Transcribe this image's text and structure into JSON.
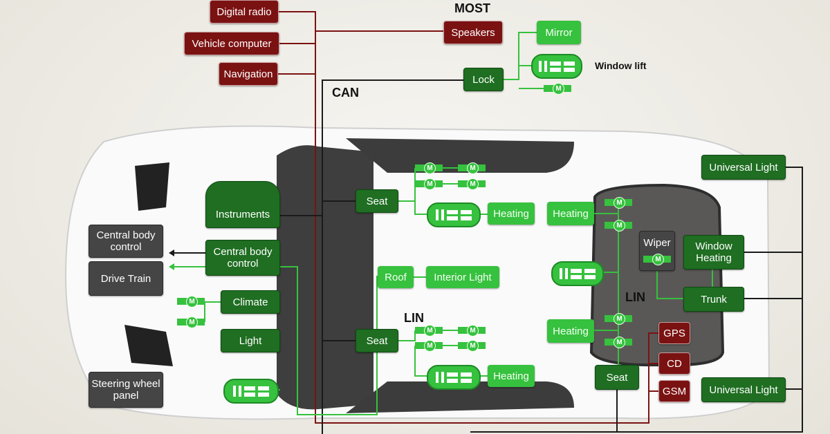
{
  "colors": {
    "most": "#7b1212",
    "can": "#1a1a1a",
    "lin": "#36c13e",
    "ecu": "#1f6e22",
    "external": "#454545"
  },
  "bus_labels": {
    "most": "MOST",
    "can": "CAN",
    "lin_front": "LIN",
    "lin_rear": "LIN"
  },
  "most_nodes": {
    "digital_radio": "Digital radio",
    "vehicle_computer": "Vehicle computer",
    "navigation": "Navigation",
    "speakers": "Speakers",
    "gps": "GPS",
    "cd": "CD",
    "gsm": "GSM"
  },
  "door": {
    "lock": "Lock",
    "mirror": "Mirror",
    "window_lift": "Window lift"
  },
  "front": {
    "instruments": "Instruments",
    "central_body_control": "Central body control",
    "climate": "Climate",
    "light": "Light"
  },
  "external": {
    "central_body_control": "Central body control",
    "drive_train": "Drive Train",
    "steering_wheel_panel": "Steering wheel panel"
  },
  "cabin": {
    "seat_front": "Seat",
    "seat_rear": "Seat",
    "heating_front": "Heating",
    "heating_rear": "Heating",
    "roof": "Roof",
    "interior_light": "Interior Light"
  },
  "rear": {
    "heating_top": "Heating",
    "heating_bottom": "Heating",
    "wiper": "Wiper",
    "window_heating": "Window Heating",
    "trunk": "Trunk",
    "seat": "Seat",
    "universal_light_top": "Universal Light",
    "universal_light_bottom": "Universal Light"
  },
  "motor_symbol": "M"
}
